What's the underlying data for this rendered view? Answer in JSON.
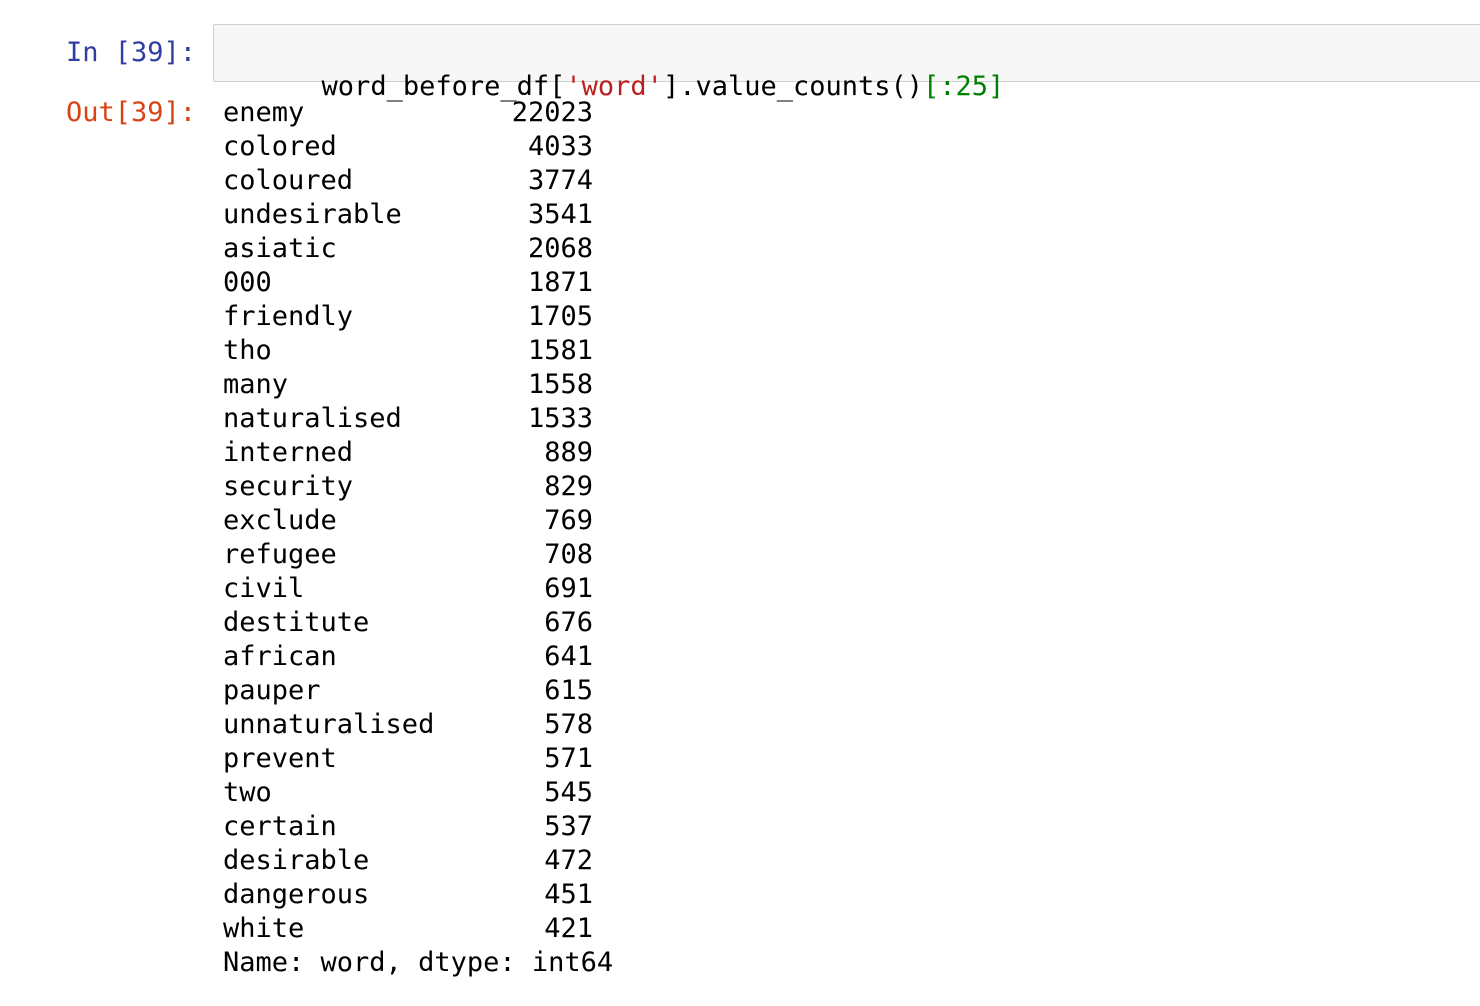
{
  "input_cell": {
    "prompt": "In [39]:",
    "code_tokens": [
      {
        "text": "word_before_df[",
        "kind": "plain"
      },
      {
        "text": "'word'",
        "kind": "str"
      },
      {
        "text": "].value_counts()",
        "kind": "plain"
      },
      {
        "text": "[:25]",
        "kind": "num"
      }
    ]
  },
  "output_cell": {
    "prompt": "Out[39]:",
    "rows": [
      {
        "word": "enemy",
        "count": "22023"
      },
      {
        "word": "colored",
        "count": "4033"
      },
      {
        "word": "coloured",
        "count": "3774"
      },
      {
        "word": "undesirable",
        "count": "3541"
      },
      {
        "word": "asiatic",
        "count": "2068"
      },
      {
        "word": "000",
        "count": "1871"
      },
      {
        "word": "friendly",
        "count": "1705"
      },
      {
        "word": "tho",
        "count": "1581"
      },
      {
        "word": "many",
        "count": "1558"
      },
      {
        "word": "naturalised",
        "count": "1533"
      },
      {
        "word": "interned",
        "count": "889"
      },
      {
        "word": "security",
        "count": "829"
      },
      {
        "word": "exclude",
        "count": "769"
      },
      {
        "word": "refugee",
        "count": "708"
      },
      {
        "word": "civil",
        "count": "691"
      },
      {
        "word": "destitute",
        "count": "676"
      },
      {
        "word": "african",
        "count": "641"
      },
      {
        "word": "pauper",
        "count": "615"
      },
      {
        "word": "unnaturalised",
        "count": "578"
      },
      {
        "word": "prevent",
        "count": "571"
      },
      {
        "word": "two",
        "count": "545"
      },
      {
        "word": "certain",
        "count": "537"
      },
      {
        "word": "desirable",
        "count": "472"
      },
      {
        "word": "dangerous",
        "count": "451"
      },
      {
        "word": "white",
        "count": "421"
      }
    ],
    "footer": "Name: word, dtype: int64"
  },
  "colors": {
    "in_prompt": "#303f9f",
    "out_prompt": "#d84315",
    "string": "#ba2121",
    "number": "#008000",
    "input_bg": "#f7f7f7",
    "input_border": "#cfcfcf"
  }
}
